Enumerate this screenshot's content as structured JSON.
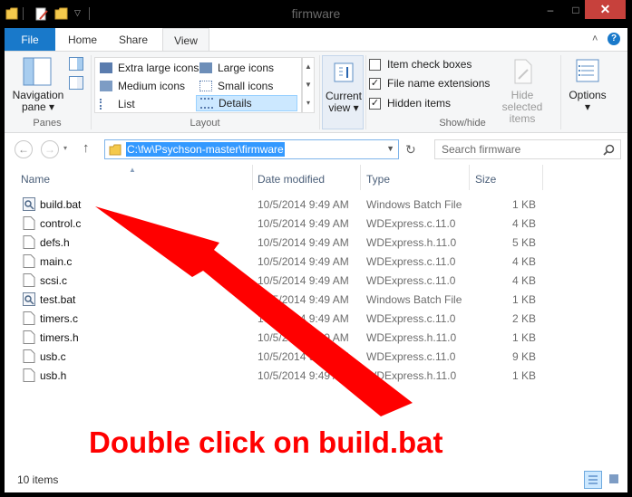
{
  "window": {
    "title": "firmware"
  },
  "window_controls": {
    "minimize": "–",
    "maximize": "□",
    "close": "✕"
  },
  "ribbon_tabs": [
    {
      "label": "File"
    },
    {
      "label": "Home"
    },
    {
      "label": "Share"
    },
    {
      "label": "View"
    }
  ],
  "panes_group": {
    "navigation_pane_label_line1": "Navigation",
    "navigation_pane_label_line2": "pane",
    "group_label": "Panes"
  },
  "layout_group": {
    "items": [
      {
        "label": "Extra large icons"
      },
      {
        "label": "Large icons"
      },
      {
        "label": "Medium icons"
      },
      {
        "label": "Small icons"
      },
      {
        "label": "List"
      },
      {
        "label": "Details"
      }
    ],
    "group_label": "Layout"
  },
  "current_view": {
    "label_line1": "Current",
    "label_line2": "view"
  },
  "show_hide_group": {
    "item_check_boxes": {
      "label": "Item check boxes",
      "checked": false
    },
    "file_name_extensions": {
      "label": "File name extensions",
      "checked": true
    },
    "hidden_items": {
      "label": "Hidden items",
      "checked": true
    },
    "hide_selected_line1": "Hide selected",
    "hide_selected_line2": "items",
    "group_label": "Show/hide"
  },
  "options": {
    "label": "Options"
  },
  "address": {
    "path": "C:\\fw\\Psychson-master\\firmware"
  },
  "search": {
    "placeholder": "Search firmware"
  },
  "columns": {
    "name": "Name",
    "date": "Date modified",
    "type": "Type",
    "size": "Size"
  },
  "files": [
    {
      "name": "build.bat",
      "date": "10/5/2014 9:49 AM",
      "type": "Windows Batch File",
      "size": "1 KB",
      "icon": "batch-file-icon"
    },
    {
      "name": "control.c",
      "date": "10/5/2014 9:49 AM",
      "type": "WDExpress.c.11.0",
      "size": "4 KB",
      "icon": "document-icon"
    },
    {
      "name": "defs.h",
      "date": "10/5/2014 9:49 AM",
      "type": "WDExpress.h.11.0",
      "size": "5 KB",
      "icon": "document-icon"
    },
    {
      "name": "main.c",
      "date": "10/5/2014 9:49 AM",
      "type": "WDExpress.c.11.0",
      "size": "4 KB",
      "icon": "document-icon"
    },
    {
      "name": "scsi.c",
      "date": "10/5/2014 9:49 AM",
      "type": "WDExpress.c.11.0",
      "size": "4 KB",
      "icon": "document-icon"
    },
    {
      "name": "test.bat",
      "date": "10/5/2014 9:49 AM",
      "type": "Windows Batch File",
      "size": "1 KB",
      "icon": "batch-file-icon"
    },
    {
      "name": "timers.c",
      "date": "10/5/2014 9:49 AM",
      "type": "WDExpress.c.11.0",
      "size": "2 KB",
      "icon": "document-icon"
    },
    {
      "name": "timers.h",
      "date": "10/5/2014 9:49 AM",
      "type": "WDExpress.h.11.0",
      "size": "1 KB",
      "icon": "document-icon"
    },
    {
      "name": "usb.c",
      "date": "10/5/2014 9:49 AM",
      "type": "WDExpress.c.11.0",
      "size": "9 KB",
      "icon": "document-icon"
    },
    {
      "name": "usb.h",
      "date": "10/5/2014 9:49 AM",
      "type": "WDExpress.h.11.0",
      "size": "1 KB",
      "icon": "document-icon"
    }
  ],
  "status": {
    "item_count": "10 items"
  },
  "annotation": {
    "text": "Double click on build.bat",
    "color": "#ff0000"
  },
  "colors": {
    "file_tab": "#1979ca",
    "selection": "#cce8ff",
    "accent": "#3399ff",
    "close": "#c7413c"
  }
}
